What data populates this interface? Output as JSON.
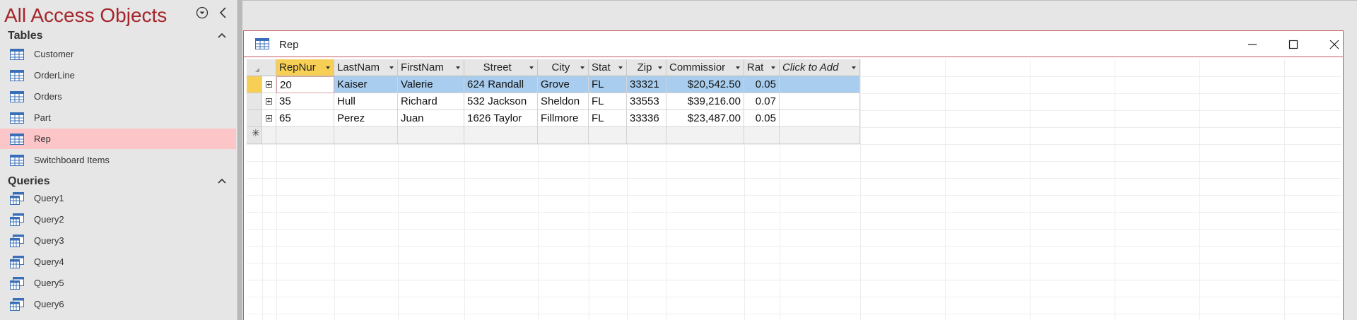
{
  "nav": {
    "title": "All Access Objects",
    "groups": {
      "tables": {
        "label": "Tables",
        "items": [
          "Customer",
          "OrderLine",
          "Orders",
          "Part",
          "Rep",
          "Switchboard Items"
        ],
        "active": "Rep"
      },
      "queries": {
        "label": "Queries",
        "items": [
          "Query1",
          "Query2",
          "Query3",
          "Query4",
          "Query5",
          "Query6"
        ]
      }
    }
  },
  "window": {
    "title": "Rep"
  },
  "datasheet": {
    "columns": [
      "RepNur",
      "LastNam",
      "FirstNam",
      "Street",
      "City",
      "Stat",
      "Zip",
      "Commissior",
      "Rat",
      "Click to Add"
    ],
    "rows": [
      [
        "20",
        "Kaiser",
        "Valerie",
        "624 Randall",
        "Grove",
        "FL",
        "33321",
        "$20,542.50",
        "0.05"
      ],
      [
        "35",
        "Hull",
        "Richard",
        "532 Jackson",
        "Sheldon",
        "FL",
        "33553",
        "$39,216.00",
        "0.07"
      ],
      [
        "65",
        "Perez",
        "Juan",
        "1626 Taylor",
        "Fillmore",
        "FL",
        "33336",
        "$23,487.00",
        "0.05"
      ]
    ],
    "selected_column": "RepNur",
    "selected_row": 0
  },
  "colors": {
    "accent": "#a4262c",
    "active_nav": "#fcc5c7",
    "selected_header": "#f7cf54",
    "selected_row": "#a8cdee"
  },
  "icons": {
    "nav_menu": "dropdown-circle-icon",
    "nav_collapse": "chevron-left-icon",
    "table_item": "table-icon",
    "query_item": "query-icon",
    "new_record": "asterisk-icon"
  }
}
